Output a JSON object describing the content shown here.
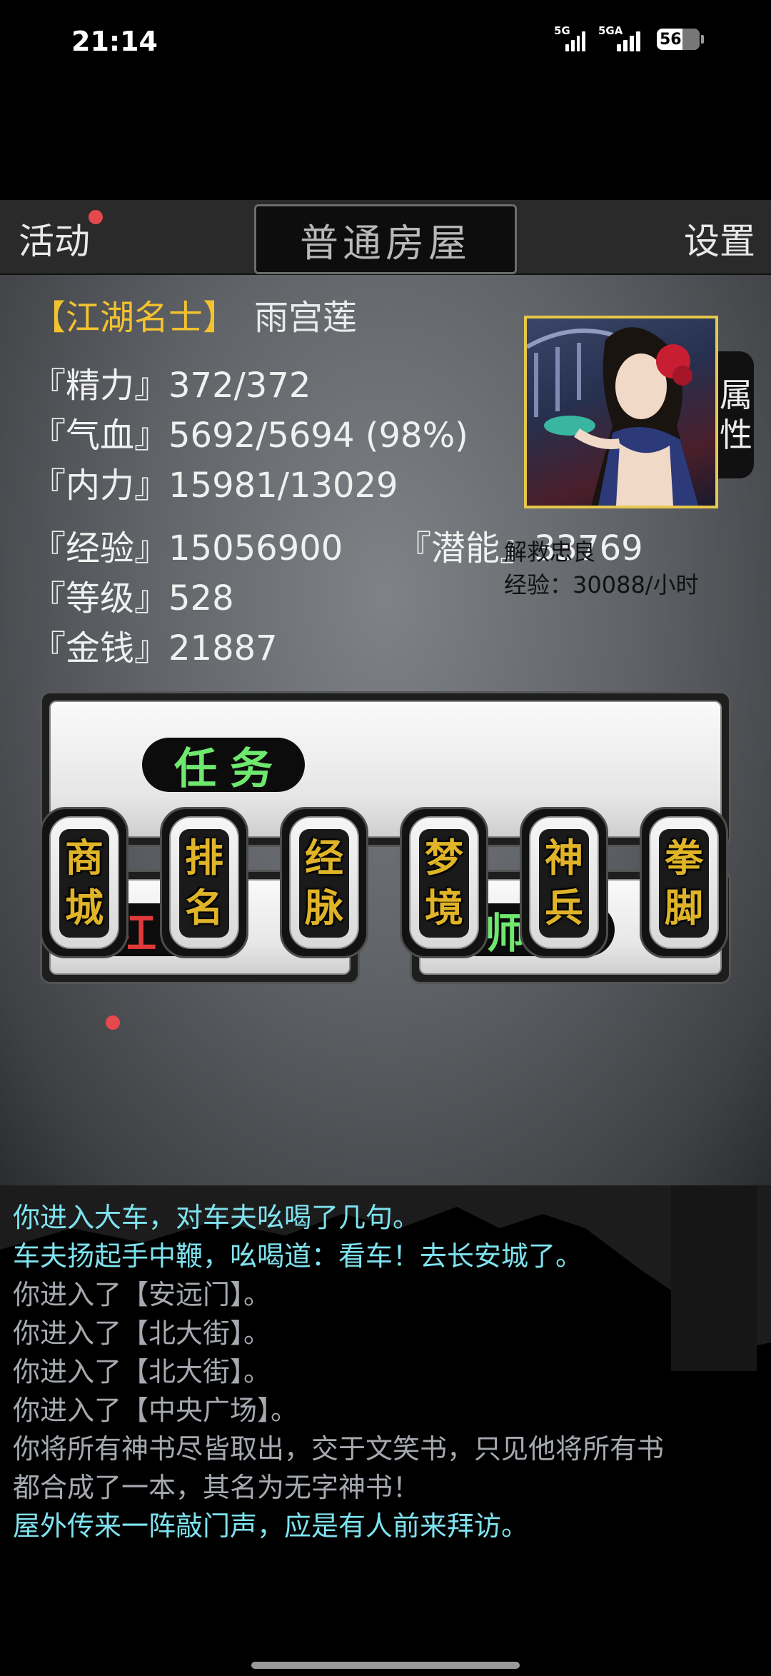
{
  "status": {
    "time": "21:14",
    "signal1": "5G",
    "signal2": "5GA",
    "battery": "56"
  },
  "header": {
    "activity": "活动",
    "room": "普通房屋",
    "settings": "设置"
  },
  "character": {
    "title": "【江湖名士】",
    "name": "雨宫莲",
    "attr_tab": [
      "属",
      "性"
    ],
    "stats": {
      "energy_label": "『精力』",
      "energy": "372/372",
      "hp_label": "『气血』",
      "hp": "5692/5694 (98%)",
      "mp_label": "『内力』",
      "mp": "15981/13029",
      "exp_label": "『经验』",
      "exp": "15056900",
      "potential_label": "『潜能』",
      "potential": "33769",
      "level_label": "『等级』",
      "level": "528",
      "money_label": "『金钱』",
      "money": "21887"
    }
  },
  "task": {
    "label": "任务",
    "name": "解救忠良",
    "exp": "经验：30088/小时"
  },
  "jianghu": {
    "label": "江湖"
  },
  "sect": {
    "label": "师门"
  },
  "tags": [
    {
      "c1": "商",
      "c2": "城"
    },
    {
      "c1": "排",
      "c2": "名"
    },
    {
      "c1": "经",
      "c2": "脉"
    },
    {
      "c1": "梦",
      "c2": "境"
    },
    {
      "c1": "神",
      "c2": "兵"
    },
    {
      "c1": "拳",
      "c2": "脚"
    }
  ],
  "log": [
    {
      "text": "你进入大车，对车夫吆喝了几句。",
      "color": "#7fe3ef"
    },
    {
      "text": "车夫扬起手中鞭，吆喝道：看车！去长安城了。",
      "color": "#7fe3ef"
    },
    {
      "text": "你进入了【安远门】。",
      "color": "#a6aab0"
    },
    {
      "text": "你进入了【北大街】。",
      "color": "#a6aab0"
    },
    {
      "text": "你进入了【北大街】。",
      "color": "#a6aab0"
    },
    {
      "text": "你进入了【中央广场】。",
      "color": "#a6aab0"
    },
    {
      "text": "你将所有神书尽皆取出，交于文笑书，只见他将所有书",
      "color": "#a6aab0"
    },
    {
      "text": "都合成了一本，其名为无字神书！",
      "color": "#a6aab0"
    },
    {
      "text": "屋外传来一阵敲门声，应是有人前来拜访。",
      "color": "#7fe3ef"
    }
  ]
}
